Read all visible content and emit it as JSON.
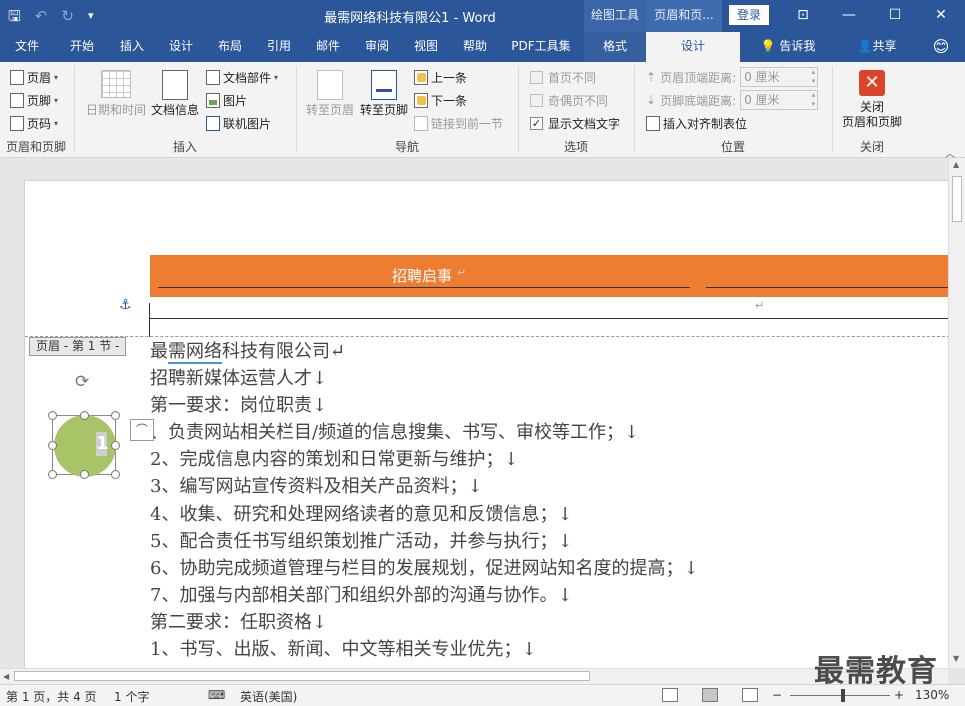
{
  "titlebar": {
    "doc_title": "最需网络科技有限公1 - Word",
    "context_draw": "绘图工具",
    "context_headerfooter": "页眉和页...",
    "login": "登录"
  },
  "tabs": [
    {
      "label": "文件"
    },
    {
      "label": "开始"
    },
    {
      "label": "插入"
    },
    {
      "label": "设计"
    },
    {
      "label": "布局"
    },
    {
      "label": "引用"
    },
    {
      "label": "邮件"
    },
    {
      "label": "审阅"
    },
    {
      "label": "视图"
    },
    {
      "label": "帮助"
    },
    {
      "label": "PDF工具集"
    },
    {
      "label": "格式"
    },
    {
      "label": "设计"
    }
  ],
  "tell_me": "告诉我",
  "share": "共享",
  "ribbon": {
    "hf": {
      "header": "页眉",
      "footer": "页脚",
      "page_number": "页码",
      "label": "页眉和页脚"
    },
    "insert": {
      "date_time": "日期和时间",
      "doc_info": "文档信息",
      "doc_parts": "文档部件",
      "picture": "图片",
      "online_picture": "联机图片",
      "label": "插入"
    },
    "nav": {
      "goto_header": "转至页眉",
      "goto_footer": "转至页脚",
      "prev": "上一条",
      "next": "下一条",
      "link_prev": "链接到前一节",
      "label": "导航"
    },
    "options": {
      "diff_first": "首页不同",
      "diff_odd_even": "奇偶页不同",
      "show_text": "显示文档文字",
      "label": "选项"
    },
    "position": {
      "header_top": "页眉顶端距离:",
      "footer_bottom": "页脚底端距离:",
      "header_val": "0 厘米",
      "footer_val": "0 厘米",
      "insert_tab": "插入对齐制表位",
      "label": "位置"
    },
    "close": {
      "button": "关闭\n页眉和页脚",
      "line1": "关闭",
      "line2": "页眉和页脚",
      "label": "关闭"
    }
  },
  "document": {
    "header_title": "招聘启事",
    "header_tag": "页眉 - 第 1 节 -",
    "shape_number": "1",
    "lines": [
      {
        "pre": "最",
        "under": "需网络",
        "post": "科技有限公司↵"
      },
      {
        "pre": "招聘新媒体运营人才↓",
        "under": "",
        "post": ""
      },
      {
        "pre": "第一要求：岗位职责↓",
        "under": "",
        "post": ""
      },
      {
        "pre": "、负责网站相关栏目/频道的信息搜集、书写、审校等工作；↓",
        "under": "",
        "post": ""
      },
      {
        "pre": "2、完成信息内容的策划和日常更新与维护；↓",
        "under": "",
        "post": ""
      },
      {
        "pre": "3、编写网站宣传资料及相关产品资料；↓",
        "under": "",
        "post": ""
      },
      {
        "pre": "4、收集、研究和处理网络读者的意见和反馈信息；↓",
        "under": "",
        "post": ""
      },
      {
        "pre": "5、配合责任书写组织策划推广活动，并参与执行；↓",
        "under": "",
        "post": ""
      },
      {
        "pre": "6、协助完成频道管理与栏目的发展规划，促进网站知名度的提高；↓",
        "under": "",
        "post": ""
      },
      {
        "pre": "7、加强与内部相关部门和组织外部的沟通与协作。↓",
        "under": "",
        "post": ""
      },
      {
        "pre": "第二要求：任职资格↓",
        "under": "",
        "post": ""
      },
      {
        "pre": "1、书写、出版、新闻、中文等相关专业优先；↓",
        "under": "",
        "post": ""
      }
    ]
  },
  "status": {
    "page": "第 1 页，共 4 页",
    "words": "1 个字",
    "language": "英语(美国)",
    "zoom": "130%",
    "zoom_minus": "−",
    "zoom_plus": "+"
  },
  "watermark": "最需教育"
}
